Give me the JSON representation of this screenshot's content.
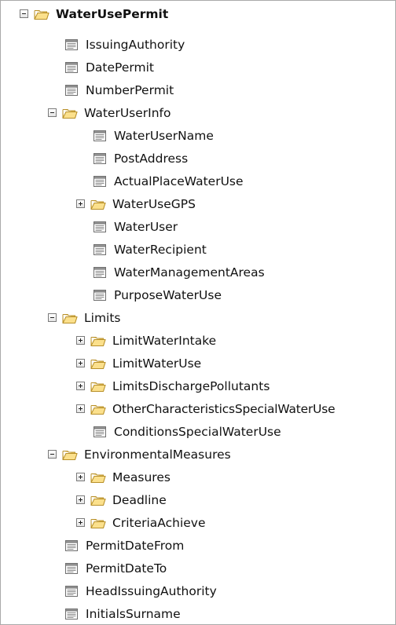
{
  "tree": {
    "root": {
      "label": "WaterUsePermit",
      "state": "expanded",
      "icon": "folder-open-icon"
    },
    "nodes": [
      {
        "label": "IssuingAuthority",
        "type": "field",
        "icon": "document-icon"
      },
      {
        "label": "DatePermit",
        "type": "field",
        "icon": "document-icon"
      },
      {
        "label": "NumberPermit",
        "type": "field",
        "icon": "document-icon"
      },
      {
        "label": "WaterUserInfo",
        "type": "folder",
        "state": "expanded",
        "icon": "folder-open-icon"
      },
      {
        "label": "WaterUserName",
        "type": "field",
        "icon": "document-icon"
      },
      {
        "label": "PostAddress",
        "type": "field",
        "icon": "document-icon"
      },
      {
        "label": "ActualPlaceWaterUse",
        "type": "field",
        "icon": "document-icon"
      },
      {
        "label": "WaterUseGPS",
        "type": "folder",
        "state": "collapsed",
        "icon": "folder-open-icon"
      },
      {
        "label": "WaterUser",
        "type": "field",
        "icon": "document-icon"
      },
      {
        "label": "WaterRecipient",
        "type": "field",
        "icon": "document-icon"
      },
      {
        "label": "WaterManagementAreas",
        "type": "field",
        "icon": "document-icon"
      },
      {
        "label": "PurposeWaterUse",
        "type": "field",
        "icon": "document-icon"
      },
      {
        "label": "Limits",
        "type": "folder",
        "state": "expanded",
        "icon": "folder-open-icon"
      },
      {
        "label": "LimitWaterIntake",
        "type": "folder",
        "state": "collapsed",
        "icon": "folder-open-icon"
      },
      {
        "label": "LimitWaterUse",
        "type": "folder",
        "state": "collapsed",
        "icon": "folder-open-icon"
      },
      {
        "label": "LimitsDischargePollutants",
        "type": "folder",
        "state": "collapsed",
        "icon": "folder-open-icon"
      },
      {
        "label": "OtherCharacteristicsSpecialWaterUse",
        "type": "folder",
        "state": "collapsed",
        "icon": "folder-open-icon"
      },
      {
        "label": "ConditionsSpecialWaterUse",
        "type": "field",
        "icon": "document-icon"
      },
      {
        "label": "EnvironmentalMeasures",
        "type": "folder",
        "state": "expanded",
        "icon": "folder-open-icon"
      },
      {
        "label": "Measures",
        "type": "folder",
        "state": "collapsed",
        "icon": "folder-open-icon"
      },
      {
        "label": "Deadline",
        "type": "folder",
        "state": "collapsed",
        "icon": "folder-open-icon"
      },
      {
        "label": "CriteriaAchieve",
        "type": "folder",
        "state": "collapsed",
        "icon": "folder-open-icon"
      },
      {
        "label": "PermitDateFrom",
        "type": "field",
        "icon": "document-icon"
      },
      {
        "label": "PermitDateTo",
        "type": "field",
        "icon": "document-icon"
      },
      {
        "label": "HeadIssuingAuthority",
        "type": "field",
        "icon": "document-icon"
      },
      {
        "label": "InitialsSurname",
        "type": "field",
        "icon": "document-icon"
      }
    ]
  },
  "colors": {
    "folder_fill": "#f8d776",
    "folder_stroke": "#c9a033",
    "document_stroke": "#6e6e6e",
    "border": "#a9a9a9"
  }
}
